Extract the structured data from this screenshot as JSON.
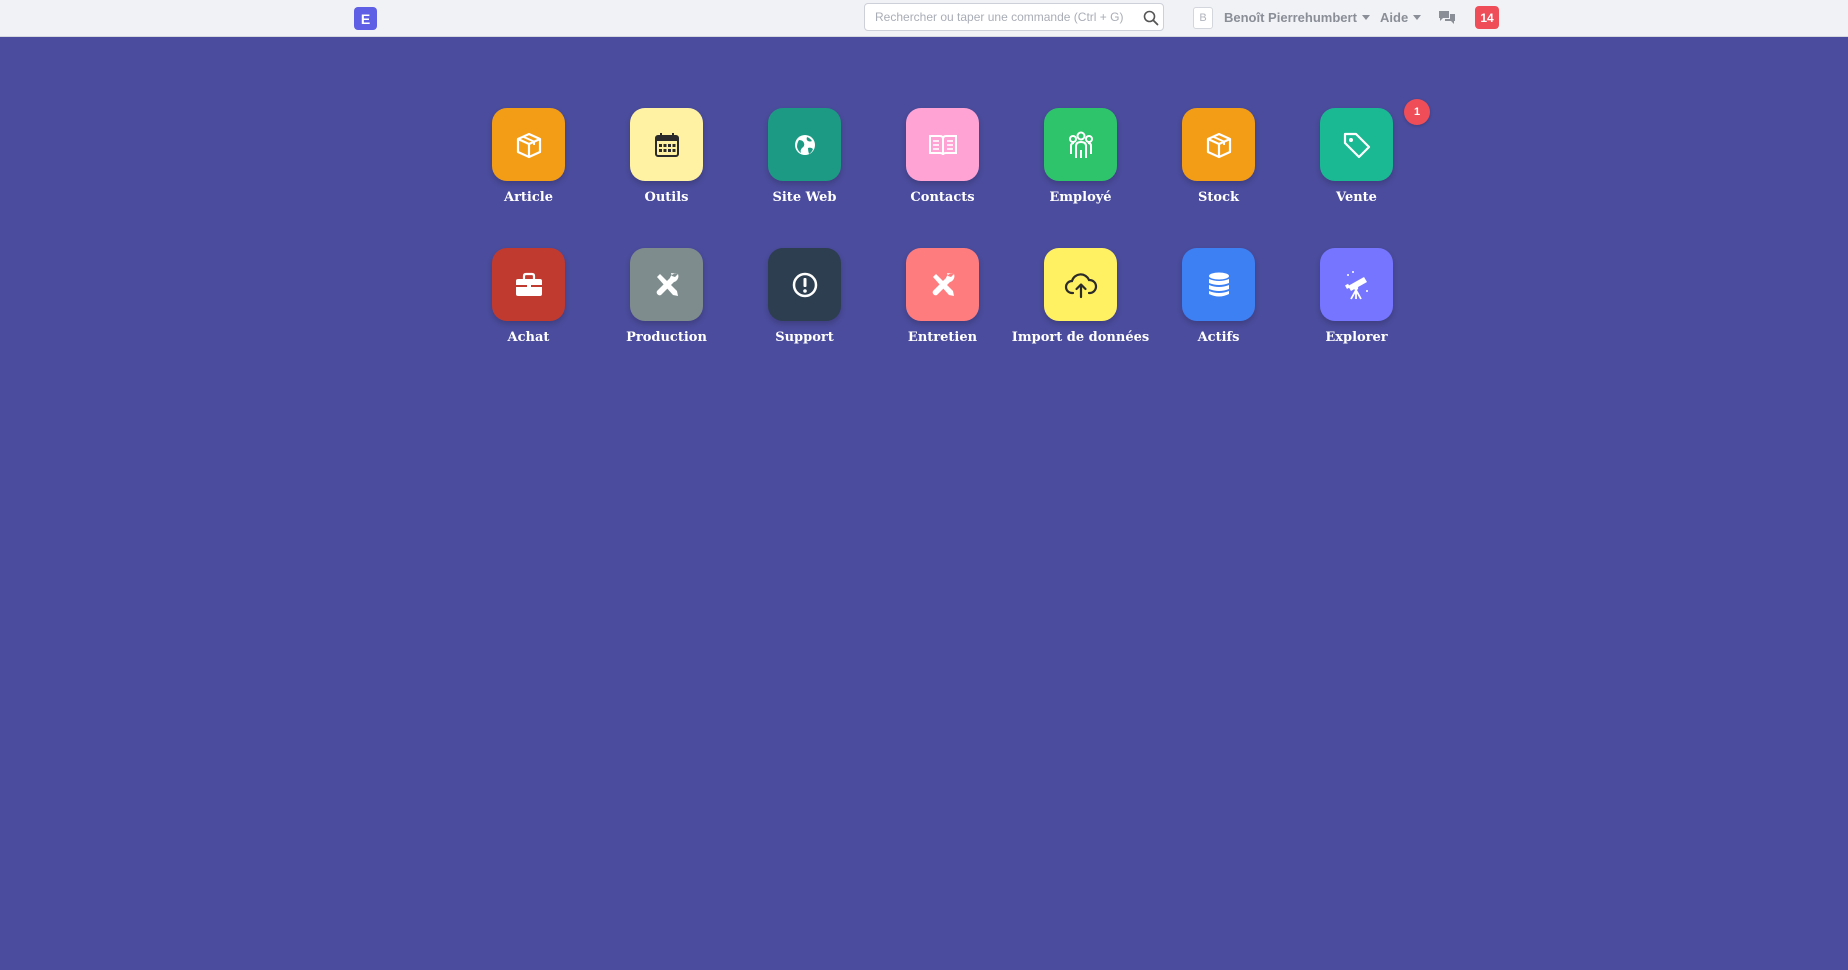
{
  "navbar": {
    "logo_letter": "E",
    "search_placeholder": "Rechercher ou taper une commande (Ctrl + G)",
    "avatar_letter": "B",
    "user_name": "Benoît Pierrehumbert",
    "help_label": "Aide",
    "notification_count": "14"
  },
  "apps": [
    {
      "label": "Article",
      "color": "#f29d15",
      "icon": "box-icon"
    },
    {
      "label": "Outils",
      "color": "#fff3a3",
      "icon": "calendar-icon"
    },
    {
      "label": "Site Web",
      "color": "#1d9a83",
      "icon": "globe-icon"
    },
    {
      "label": "Contacts",
      "color": "#ffa3d4",
      "icon": "book-icon"
    },
    {
      "label": "Employé",
      "color": "#2ec46b",
      "icon": "people-icon"
    },
    {
      "label": "Stock",
      "color": "#f29d15",
      "icon": "box-icon"
    },
    {
      "label": "Vente",
      "color": "#1bb894",
      "icon": "tag-icon",
      "badge": "1"
    },
    {
      "label": "Achat",
      "color": "#c03a2f",
      "icon": "briefcase-icon"
    },
    {
      "label": "Production",
      "color": "#7f8c8d",
      "icon": "tools-icon"
    },
    {
      "label": "Support",
      "color": "#2d3e50",
      "icon": "exclamation-icon"
    },
    {
      "label": "Entretien",
      "color": "#fe7c7e",
      "icon": "tools-icon"
    },
    {
      "label": "Import de données",
      "color": "#fff162",
      "icon": "cloud-upload-icon"
    },
    {
      "label": "Actifs",
      "color": "#3d80f4",
      "icon": "database-icon"
    },
    {
      "label": "Explorer",
      "color": "#7575ff",
      "icon": "telescope-icon"
    }
  ]
}
